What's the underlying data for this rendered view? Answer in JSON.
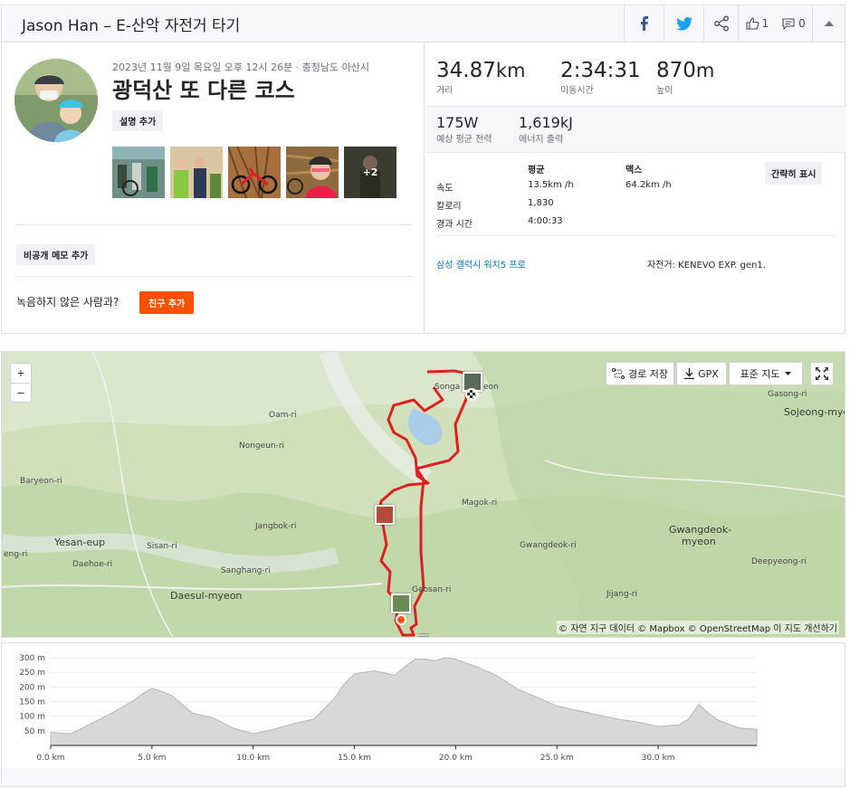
{
  "header": {
    "title": "Jason Han – E-산악 자전거 타기",
    "kudos_count": "1",
    "comment_count": "0"
  },
  "activity": {
    "date_location": "2023년 11월 9일 목요일 오후 12시 26분 · 충청남도 아산시",
    "name": "광덕산 또 다른 코스",
    "add_description": "설명 추가",
    "photos_more": "+2",
    "private_note": "비공개 메모 추가",
    "partner_prompt": "녹음하지 않은 사람과?",
    "add_friend": "친구 추가"
  },
  "stats": {
    "distance": {
      "value": "34.87",
      "unit": "km",
      "label": "거리"
    },
    "moving_time": {
      "value": "2:34:31",
      "label": "이동시간"
    },
    "elevation": {
      "value": "870",
      "unit": "m",
      "label": "높이"
    },
    "power": {
      "value": "175",
      "unit": "W",
      "label": "예상 평균 전력"
    },
    "energy": {
      "value": "1,619",
      "unit": "kJ",
      "label": "에너지 출력"
    },
    "table_headers": {
      "avg": "평균",
      "max": "맥스"
    },
    "rows": [
      {
        "label": "속도",
        "avg": "13.5km /h",
        "max": "64.2km /h"
      },
      {
        "label": "칼로리",
        "avg": "1,830",
        "max": ""
      },
      {
        "label": "경과 시간",
        "avg": "4:00:33",
        "max": ""
      }
    ],
    "simple_view": "간략히 표시",
    "device": "삼성 갤럭시 워치5 프로",
    "bike": "자전거: KENEVO EXP. gen1."
  },
  "map": {
    "zoom_in": "+",
    "zoom_out": "−",
    "save_route": "경로 저장",
    "gpx": "GPX",
    "map_style": "표준 지도",
    "attribution": "© 자연 지구 데이터 © Mapbox © OpenStreetMap 이 지도 개선하기",
    "places": [
      {
        "name": "Songa",
        "big": false
      },
      {
        "name": "eon",
        "big": false
      },
      {
        "name": "Oam-ri",
        "big": false
      },
      {
        "name": "Nongeun-ri",
        "big": false
      },
      {
        "name": "Baryeon-ri",
        "big": false
      },
      {
        "name": "Jangbok-ri",
        "big": false
      },
      {
        "name": "Magok-ri",
        "big": false
      },
      {
        "name": "Yesan-eup",
        "big": true
      },
      {
        "name": "Sisan-ri",
        "big": false
      },
      {
        "name": "Daehoe-ri",
        "big": false
      },
      {
        "name": "Sanghang-ri",
        "big": false
      },
      {
        "name": "Daesul-myeon",
        "big": true
      },
      {
        "name": "Gwangdeok-ri",
        "big": false
      },
      {
        "name": "Gwangdeok-",
        "big": true
      },
      {
        "name": "myeon",
        "big": true
      },
      {
        "name": "Deepyeong-ri",
        "big": false
      },
      {
        "name": "Jijang-ri",
        "big": false
      },
      {
        "name": "Geosan-ri",
        "big": false
      },
      {
        "name": "Gasong-ri",
        "big": false
      },
      {
        "name": "Sojeong-myeo",
        "big": true
      },
      {
        "name": "eng-ri",
        "big": false
      }
    ]
  },
  "chart_data": {
    "type": "area",
    "title": "",
    "xlabel": "",
    "ylabel": "",
    "x_unit": "km",
    "y_unit": "m",
    "xlim": [
      0,
      34.87
    ],
    "ylim": [
      0,
      300
    ],
    "y_ticks": [
      "50 m",
      "100 m",
      "150 m",
      "200 m",
      "250 m",
      "300 m"
    ],
    "x_ticks": [
      "0.0 km",
      "5.0 km",
      "10.0 km",
      "15.0 km",
      "20.0 km",
      "25.0 km",
      "30.0 km"
    ],
    "x": [
      0,
      1,
      2,
      3,
      4,
      4.5,
      5,
      5.5,
      6,
      7,
      8,
      9,
      10,
      11,
      12,
      13,
      14,
      14.5,
      15,
      16,
      17,
      17.5,
      18,
      18.5,
      19,
      19.5,
      20,
      21,
      22,
      23,
      24,
      25,
      26,
      27,
      28,
      29,
      30,
      31,
      31.5,
      32,
      32.5,
      33,
      34,
      34.87
    ],
    "y": [
      45,
      40,
      75,
      110,
      150,
      175,
      195,
      185,
      170,
      110,
      95,
      60,
      40,
      55,
      75,
      90,
      160,
      210,
      245,
      255,
      240,
      270,
      295,
      295,
      290,
      300,
      295,
      270,
      240,
      195,
      165,
      135,
      120,
      105,
      90,
      80,
      65,
      70,
      90,
      140,
      110,
      85,
      60,
      55
    ]
  },
  "colors": {
    "brand": "#fc5200",
    "route": "#e01f1f",
    "link": "#0072cc",
    "elevation_fill": "#d8d8d8"
  }
}
